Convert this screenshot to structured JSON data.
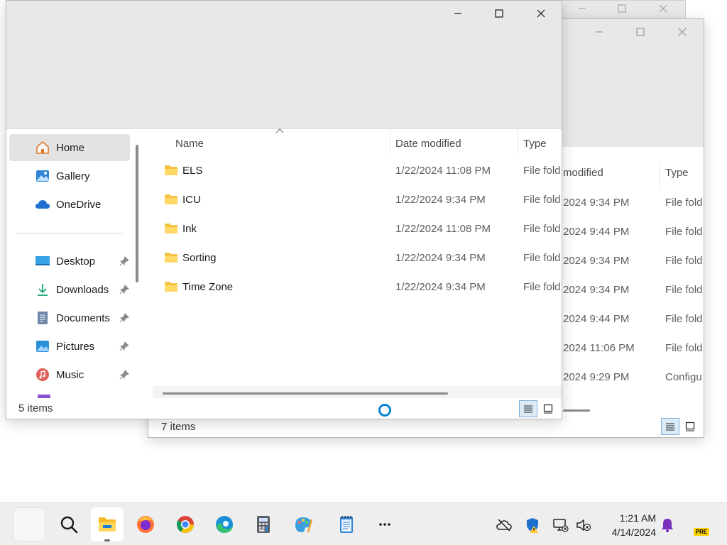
{
  "window_front": {
    "nav": {
      "items": [
        {
          "label": "Home"
        },
        {
          "label": "Gallery"
        },
        {
          "label": "OneDrive"
        },
        {
          "label": "Desktop"
        },
        {
          "label": "Downloads"
        },
        {
          "label": "Documents"
        },
        {
          "label": "Pictures"
        },
        {
          "label": "Music"
        }
      ]
    },
    "columns": {
      "name": "Name",
      "date": "Date modified",
      "type": "Type"
    },
    "files": [
      {
        "name": "ELS",
        "date": "1/22/2024 11:08 PM",
        "type": "File fold"
      },
      {
        "name": "ICU",
        "date": "1/22/2024 9:34 PM",
        "type": "File fold"
      },
      {
        "name": "Ink",
        "date": "1/22/2024 11:08 PM",
        "type": "File fold"
      },
      {
        "name": "Sorting",
        "date": "1/22/2024 9:34 PM",
        "type": "File fold"
      },
      {
        "name": "Time Zone",
        "date": "1/22/2024 9:34 PM",
        "type": "File fold"
      }
    ],
    "status": "5 items"
  },
  "window_mid": {
    "columns": {
      "date": "modified",
      "type": "Type"
    },
    "files": [
      {
        "date": "2024 9:34 PM",
        "type": "File fold"
      },
      {
        "date": "2024 9:44 PM",
        "type": "File fold"
      },
      {
        "date": "2024 9:34 PM",
        "type": "File fold"
      },
      {
        "date": "2024 9:34 PM",
        "type": "File fold"
      },
      {
        "date": "2024 9:44 PM",
        "type": "File fold"
      },
      {
        "date": "2024 11:06 PM",
        "type": "File fold"
      },
      {
        "date": "2024 9:29 PM",
        "type": "Configu"
      }
    ],
    "status": "7 items"
  },
  "taskbar": {
    "apps": [
      "start",
      "search-icon",
      "file-explorer-icon",
      "firefox-icon",
      "chrome-icon",
      "edge-icon",
      "calculator-icon",
      "paint-icon",
      "notepad-icon",
      "more-icon"
    ],
    "clock": {
      "time": "1:21 AM",
      "date": "4/14/2024"
    },
    "badge": "PRE"
  }
}
